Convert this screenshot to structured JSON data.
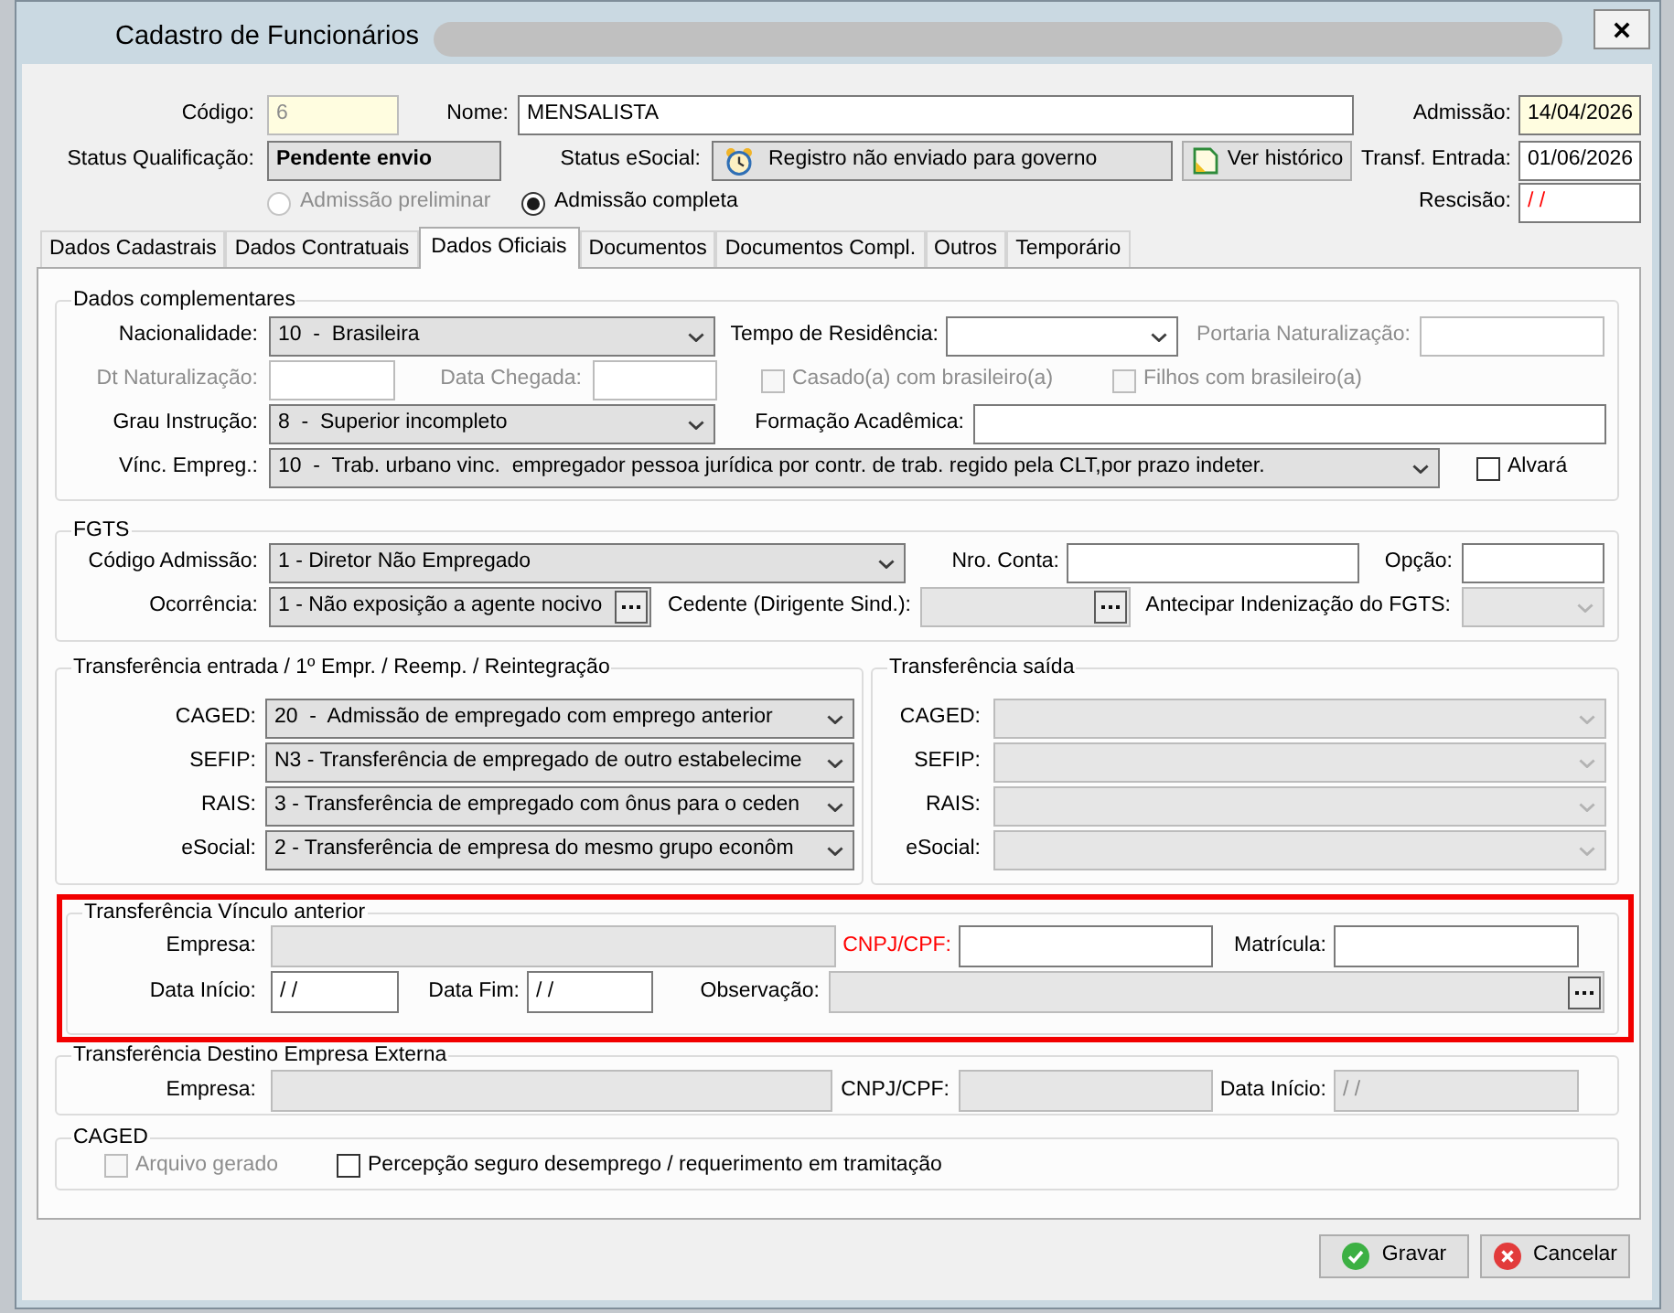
{
  "window": {
    "title": "Cadastro de Funcionários"
  },
  "header": {
    "rows": [
      [
        {
          "kind": "text",
          "label": "Código:",
          "value": "6",
          "readonly": true,
          "highlighted": true
        },
        {
          "kind": "text",
          "label": "Nome:",
          "value": "MENSALISTA"
        },
        {
          "kind": "date",
          "label": "Admissão:",
          "value": "14/04/2026",
          "highlighted": true
        }
      ],
      [
        {
          "kind": "display",
          "label": "Status Qualificação:",
          "value": "Pendente envio"
        },
        {
          "kind": "display",
          "label": "Status eSocial:",
          "value": "Registro não enviado para governo"
        },
        {
          "kind": "button",
          "label": "Ver histórico"
        },
        {
          "kind": "date",
          "label": "Transf. Entrada:",
          "value": "01/06/2026"
        }
      ],
      [
        {
          "kind": "radio",
          "label": "Admissão preliminar",
          "selected": false,
          "disabled": true
        },
        {
          "kind": "radio",
          "label": "Admissão completa",
          "selected": true,
          "disabled": false
        },
        {
          "kind": "date",
          "label": "Rescisão:",
          "value": "/ /",
          "alert": true
        }
      ]
    ]
  },
  "tabs": [
    {
      "label": "Dados Cadastrais",
      "selected": false
    },
    {
      "label": "Dados Contratuais",
      "selected": false
    },
    {
      "label": "Dados Oficiais",
      "selected": true
    },
    {
      "label": "Documentos",
      "selected": false
    },
    {
      "label": "Documentos Compl.",
      "selected": false
    },
    {
      "label": "Outros",
      "selected": false
    },
    {
      "label": "Temporário",
      "selected": false
    }
  ],
  "panel": {
    "groups": [
      {
        "title": "Dados complementares",
        "rows": [
          [
            {
              "kind": "dropdown",
              "label": "Nacionalidade:",
              "value": "10  -  Brasileira"
            },
            {
              "kind": "combobox",
              "label": "Tempo de Residência:"
            },
            {
              "kind": "text",
              "label": "Portaria Naturalização:",
              "disabled": true
            }
          ],
          [
            {
              "kind": "text",
              "label": "Dt Naturalização:",
              "disabled": true
            },
            {
              "kind": "text",
              "label": "Data Chegada:",
              "disabled": true
            },
            {
              "kind": "checkgroup",
              "options": [
                {
                  "kind": "checkbox",
                  "label": "Casado(a) com brasileiro(a)",
                  "checked": false,
                  "disabled": true
                },
                {
                  "kind": "checkbox",
                  "label": "Filhos com brasileiro(a)",
                  "checked": false,
                  "disabled": true
                }
              ]
            }
          ],
          [
            {
              "kind": "dropdown",
              "label": "Grau Instrução:",
              "value": "8  -  Superior incompleto"
            },
            {
              "kind": "text",
              "label": "Formação Acadêmica:"
            }
          ],
          [
            {
              "kind": "dropdown",
              "label": "Vínc. Empreg.:",
              "value": "10  -  Trab. urbano vinc.  empregador pessoa jurídica por contr. de trab. regido pela CLT,por prazo indeter."
            },
            {
              "kind": "checkbox",
              "label": "Alvará",
              "checked": false,
              "disabled": false
            }
          ]
        ]
      },
      {
        "title": "FGTS",
        "rows": [
          [
            {
              "kind": "dropdown",
              "label": "Código Admissão:",
              "value": "1 - Diretor Não Empregado"
            },
            {
              "kind": "text",
              "label": "Nro. Conta:"
            },
            {
              "kind": "text",
              "label": "Opção:"
            }
          ],
          [
            {
              "kind": "lookup",
              "label": "Ocorrência:",
              "value": "1 - Não exposição a agente nocivo"
            },
            {
              "kind": "lookup",
              "label": "Cedente (Dirigente Sind.):",
              "readonly": true
            },
            {
              "kind": "dropdown",
              "label": "Antecipar Indenização do FGTS:",
              "readonly": true
            }
          ]
        ]
      },
      {
        "title": "Transferência entrada / 1º Empr. / Reemp. / Reintegração",
        "rows": [
          [
            {
              "kind": "dropdown",
              "label": "CAGED:",
              "value": "20  -  Admissão de empregado com emprego anterior"
            }
          ],
          [
            {
              "kind": "dropdown",
              "label": "SEFIP:",
              "value": "N3 - Transferência de empregado de outro estabelecime"
            }
          ],
          [
            {
              "kind": "dropdown",
              "label": "RAIS:",
              "value": "3 - Transferência de empregado com ônus para o ceden"
            }
          ],
          [
            {
              "kind": "dropdown",
              "label": "eSocial:",
              "value": "2 - Transferência de empresa do mesmo grupo econôm"
            }
          ]
        ]
      },
      {
        "title": "Transferência saída",
        "rows": [
          [
            {
              "kind": "dropdown",
              "label": "CAGED:",
              "readonly": true
            }
          ],
          [
            {
              "kind": "dropdown",
              "label": "SEFIP:",
              "readonly": true
            }
          ],
          [
            {
              "kind": "dropdown",
              "label": "RAIS:",
              "readonly": true
            }
          ],
          [
            {
              "kind": "dropdown",
              "label": "eSocial:",
              "readonly": true
            }
          ]
        ]
      },
      {
        "title": "Transferência Vínculo anterior",
        "highlighted": true,
        "rows": [
          [
            {
              "kind": "text",
              "label": "Empresa:",
              "readonly": true
            },
            {
              "kind": "text",
              "label": "CNPJ/CPF:",
              "required": true
            },
            {
              "kind": "text",
              "label": "Matrícula:"
            }
          ],
          [
            {
              "kind": "date",
              "label": "Data Início:",
              "value": "/ /"
            },
            {
              "kind": "date",
              "label": "Data Fim:",
              "value": "/ /"
            },
            {
              "kind": "lookup",
              "label": "Observação:",
              "readonly": true
            }
          ]
        ]
      },
      {
        "title": "Transferência Destino Empresa Externa",
        "rows": [
          [
            {
              "kind": "text",
              "label": "Empresa:",
              "readonly": true
            },
            {
              "kind": "text",
              "label": "CNPJ/CPF:",
              "readonly": true
            },
            {
              "kind": "date",
              "label": "Data Início:",
              "value": "/ /",
              "readonly": true
            }
          ]
        ]
      },
      {
        "title": "CAGED",
        "rows": [
          [
            {
              "kind": "checkbox",
              "label": "Arquivo gerado",
              "checked": false,
              "disabled": true
            },
            {
              "kind": "checkbox",
              "label": "Percepção seguro desemprego / requerimento em tramitação",
              "checked": false,
              "disabled": false
            }
          ]
        ]
      }
    ]
  },
  "buttons": [
    "Gravar",
    "Cancelar"
  ]
}
